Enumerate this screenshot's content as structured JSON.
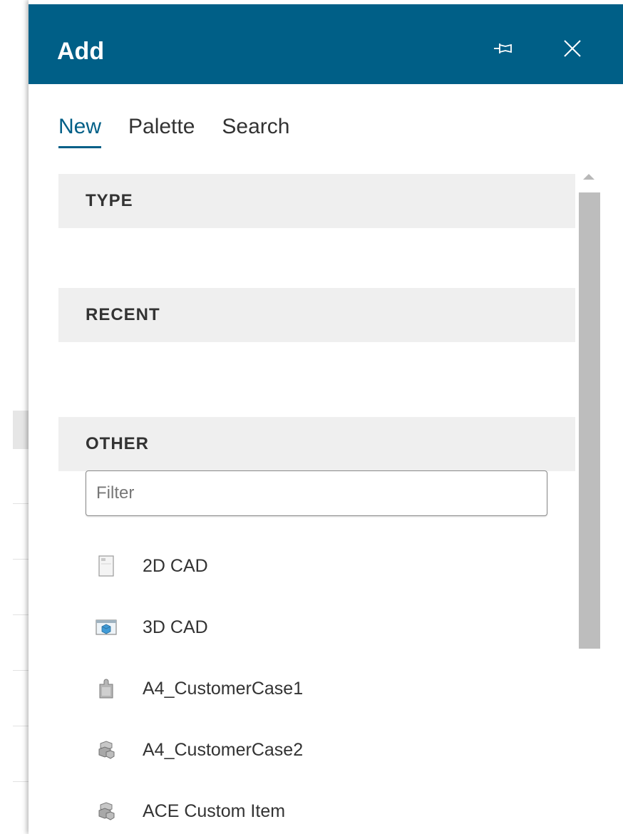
{
  "panel": {
    "title": "Add",
    "header_color": "#005f87",
    "pin_icon": "pin-icon",
    "close_icon": "close-icon"
  },
  "tabs": [
    {
      "label": "New",
      "active": true
    },
    {
      "label": "Palette",
      "active": false
    },
    {
      "label": "Search",
      "active": false
    }
  ],
  "sections": {
    "type": "TYPE",
    "recent": "RECENT",
    "other": "OTHER"
  },
  "filter": {
    "placeholder": "Filter",
    "value": ""
  },
  "items": [
    {
      "label": "2D CAD",
      "icon": "document-icon"
    },
    {
      "label": "3D CAD",
      "icon": "cube-window-icon"
    },
    {
      "label": "A4_CustomerCase1",
      "icon": "puzzle-icon"
    },
    {
      "label": "A4_CustomerCase2",
      "icon": "blocks-icon"
    },
    {
      "label": "ACE Custom Item",
      "icon": "blocks-icon"
    }
  ]
}
